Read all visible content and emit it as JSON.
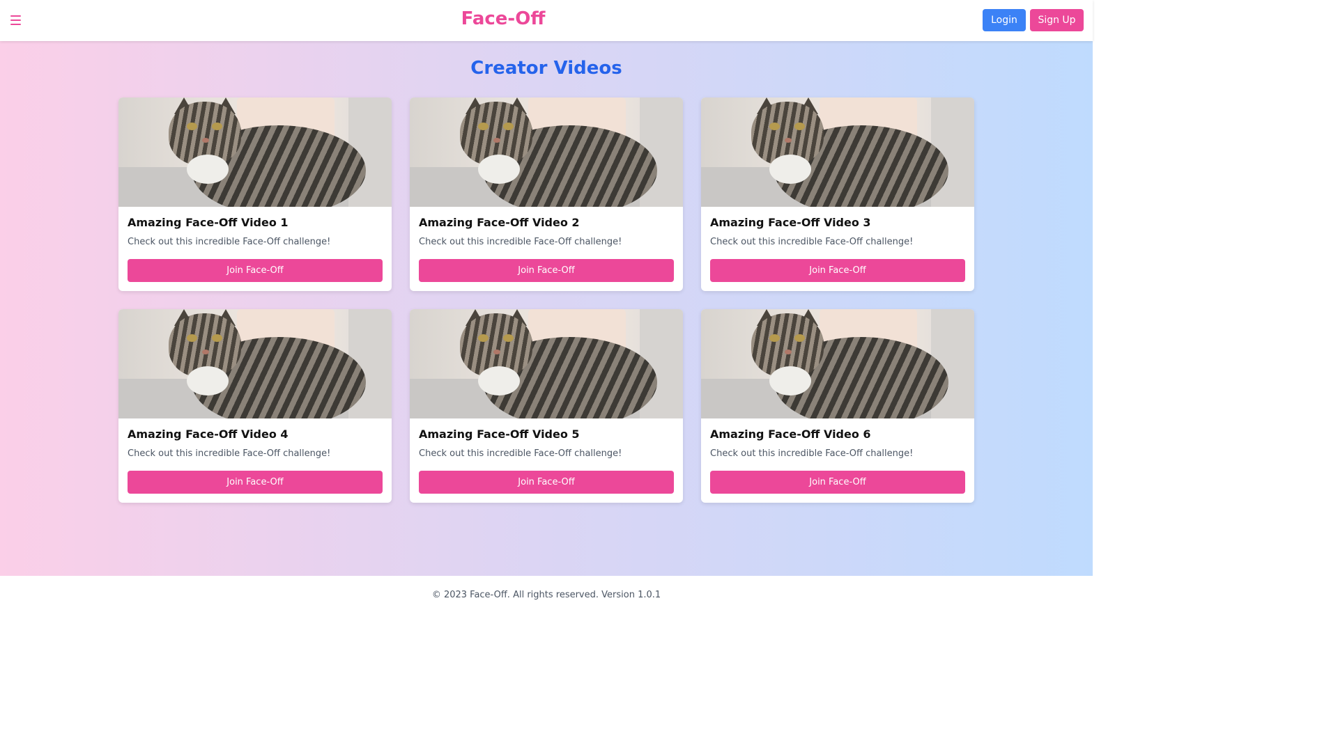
{
  "header": {
    "brand": "Face-Off",
    "menu_icon": "hamburger-menu-icon",
    "login_label": "Login",
    "signup_label": "Sign Up"
  },
  "main": {
    "title": "Creator Videos",
    "cards": [
      {
        "title": "Amazing Face-Off Video 1",
        "description": "Check out this incredible Face-Off challenge!",
        "button": "Join Face-Off"
      },
      {
        "title": "Amazing Face-Off Video 2",
        "description": "Check out this incredible Face-Off challenge!",
        "button": "Join Face-Off"
      },
      {
        "title": "Amazing Face-Off Video 3",
        "description": "Check out this incredible Face-Off challenge!",
        "button": "Join Face-Off"
      },
      {
        "title": "Amazing Face-Off Video 4",
        "description": "Check out this incredible Face-Off challenge!",
        "button": "Join Face-Off"
      },
      {
        "title": "Amazing Face-Off Video 5",
        "description": "Check out this incredible Face-Off challenge!",
        "button": "Join Face-Off"
      },
      {
        "title": "Amazing Face-Off Video 6",
        "description": "Check out this incredible Face-Off challenge!",
        "button": "Join Face-Off"
      }
    ]
  },
  "footer": {
    "text": "© 2023 Face-Off. All rights reserved. Version 1.0.1"
  },
  "colors": {
    "brand_pink": "#ec4899",
    "login_blue": "#3b82f6",
    "title_blue": "#2563eb",
    "gradient_start": "#fbcfe8",
    "gradient_end": "#bfdbfe"
  }
}
